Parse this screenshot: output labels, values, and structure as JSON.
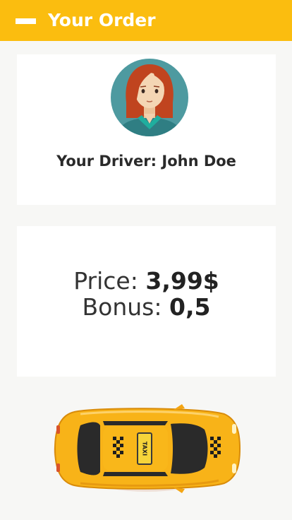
{
  "header": {
    "title": "Your Order",
    "icon": "menu-icon"
  },
  "driver": {
    "label_prefix": "Your Driver:",
    "name": "John Doe",
    "avatar_icon": "driver-avatar-icon"
  },
  "order": {
    "price_label": "Price:",
    "price_value": "3,99$",
    "bonus_label": "Bonus:",
    "bonus_value": "0,5"
  },
  "taxi": {
    "roof_sign": "TAXI",
    "icon": "taxi-car-icon"
  },
  "colors": {
    "brand_yellow": "#fbbd0f",
    "background": "#f7f7f5",
    "card": "#ffffff"
  }
}
